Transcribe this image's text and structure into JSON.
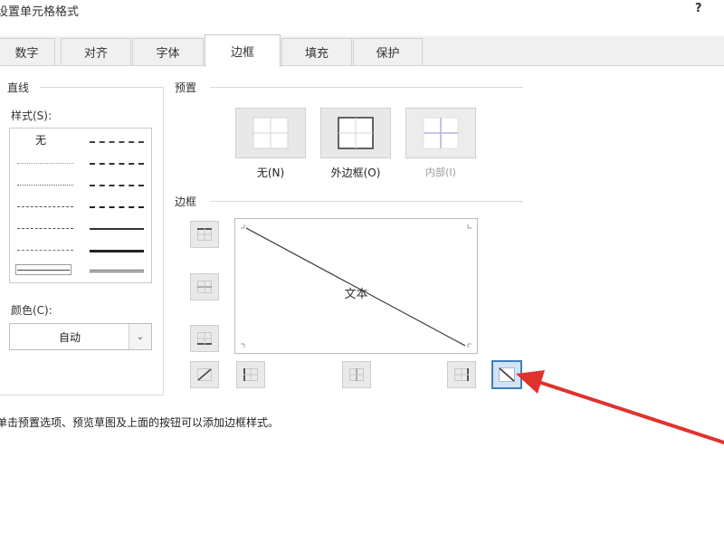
{
  "dialog": {
    "title": "设置单元格格式",
    "help": "?"
  },
  "tabs": [
    {
      "label": "数字",
      "active": false
    },
    {
      "label": "对齐",
      "active": false
    },
    {
      "label": "字体",
      "active": false
    },
    {
      "label": "边框",
      "active": true
    },
    {
      "label": "填充",
      "active": false
    },
    {
      "label": "保护",
      "active": false
    }
  ],
  "line_group": {
    "title": "直线",
    "style_label": "样式(S):",
    "none_label": "无",
    "color_label": "颜色(C):",
    "color_value": "自动"
  },
  "presets": {
    "title": "预置",
    "items": [
      {
        "label": "无(N)",
        "enabled": true
      },
      {
        "label": "外边框(O)",
        "enabled": true
      },
      {
        "label": "内部(I)",
        "enabled": false
      }
    ]
  },
  "border": {
    "title": "边框",
    "preview_text": "文本"
  },
  "hint": "单击预置选项、预览草图及上面的按钮可以添加边框样式。",
  "colors": {
    "accent": "#3c7fc0",
    "arrow": "#e0322d",
    "disabled_icon": "#b9aeda"
  }
}
